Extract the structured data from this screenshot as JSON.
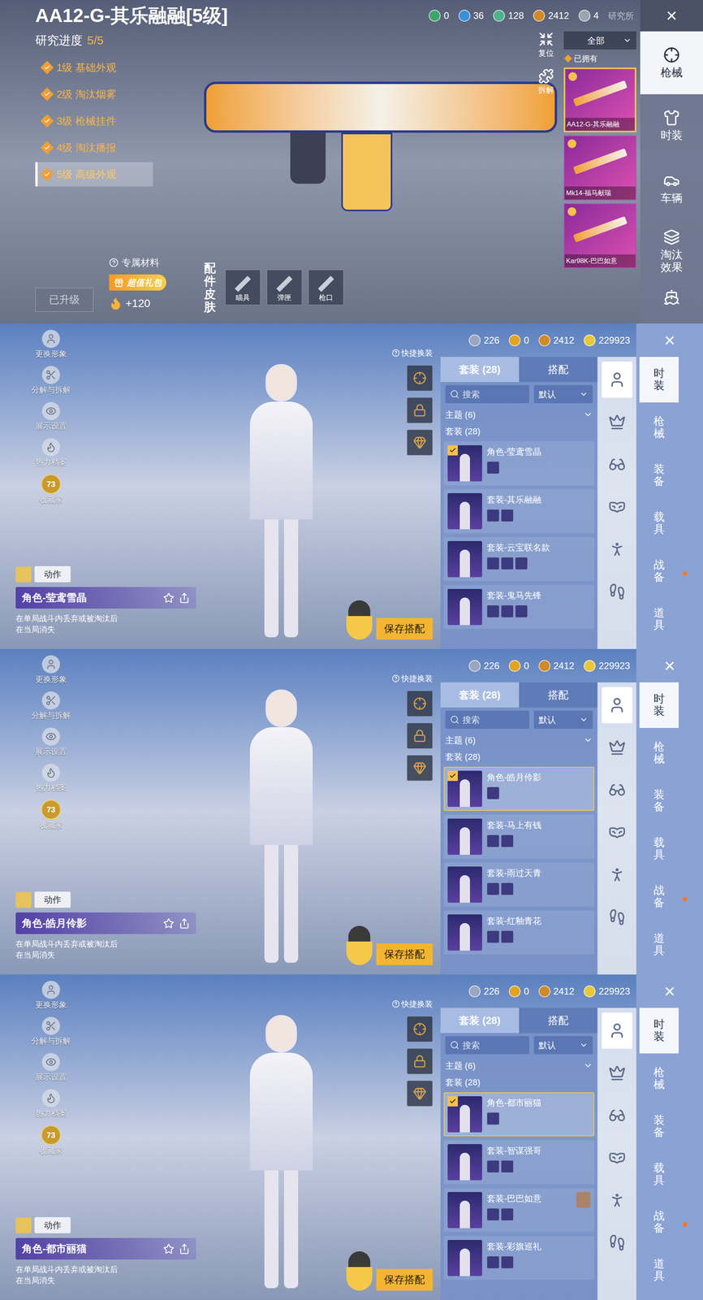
{
  "weapon_panel": {
    "title": "AA12-G-其乐融融[5级]",
    "progress": {
      "label": "研究进度",
      "value": "5/5"
    },
    "levels": [
      {
        "label": "1级 基础外观",
        "done": true,
        "selected": false
      },
      {
        "label": "2级 淘汰烟雾",
        "done": true,
        "selected": false
      },
      {
        "label": "3级 枪械挂件",
        "done": true,
        "selected": false
      },
      {
        "label": "4级 淘汰播报",
        "done": true,
        "selected": false
      },
      {
        "label": "5级 高级外观",
        "done": true,
        "selected": true
      }
    ],
    "currencies": [
      {
        "value": "0",
        "color": "#3fa56b"
      },
      {
        "value": "36",
        "color": "#3b8fd6"
      },
      {
        "value": "128",
        "color": "#4fb08a"
      },
      {
        "value": "2412",
        "color": "#d08a2a"
      },
      {
        "value": "4",
        "color": "#9aa3b0"
      }
    ],
    "lab": "研究所",
    "close": "×",
    "tools": [
      "复位",
      "拆解"
    ],
    "filter": "全部",
    "owned": "已拥有",
    "skins": [
      {
        "name": "AA12-G-其乐融融",
        "selected": true
      },
      {
        "name": "Mk14-福马献瑞",
        "selected": false
      },
      {
        "name": "Kar98K-巴巴如意",
        "selected": false
      }
    ],
    "nav": [
      {
        "label": "枪械",
        "selected": true
      },
      {
        "label": "时装",
        "selected": false
      },
      {
        "label": "车辆",
        "selected": false
      },
      {
        "label": "淘汰效果",
        "selected": false
      }
    ],
    "materials": "专属材料",
    "gift": "超值礼包",
    "material_count": "+120",
    "upgrade": {
      "label": "已升级",
      "disabled": true
    },
    "accessories_title": "配件皮肤",
    "accessories": [
      "瞄具",
      "弹匣",
      "枪口"
    ]
  },
  "outfit_panels": [
    {
      "currencies": [
        {
          "value": "226",
          "color": "#9aa6c0"
        },
        {
          "value": "0",
          "color": "#e0a526"
        },
        {
          "value": "2412",
          "color": "#d08a2a"
        },
        {
          "value": "229923",
          "color": "#e8c83a"
        }
      ],
      "close": "×",
      "menu": [
        "更换形象",
        "分解与拆解",
        "展示设置",
        "热力档案",
        "收藏家"
      ],
      "collector_level": "73",
      "action": "动作",
      "character": "角色-莹鸢雪晶",
      "notes": [
        "在单局战斗内丢弃或被淘汰后",
        "在当局消失"
      ],
      "quick_change": "快捷换装",
      "tabs": [
        {
          "label": "套装 (28)",
          "selected": true
        },
        {
          "label": "搭配",
          "selected": false
        }
      ],
      "search": "搜索",
      "sort": "默认",
      "theme": "主题 (6)",
      "sets": "套装 (28)",
      "items": [
        {
          "name": "角色-莹鸢雪晶",
          "parts": 1,
          "equipped": true,
          "selected": false,
          "friend": false
        },
        {
          "name": "套装-其乐融融",
          "parts": 2,
          "equipped": false,
          "selected": false,
          "friend": false
        },
        {
          "name": "套装-云宝联名款",
          "parts": 3,
          "equipped": false,
          "selected": false,
          "friend": false
        },
        {
          "name": "套装-鬼马先锋",
          "parts": 3,
          "equipped": false,
          "selected": false,
          "friend": false
        }
      ],
      "save": "保存搭配",
      "slots": [
        {
          "selected": true
        },
        {
          "selected": false
        },
        {
          "selected": false
        },
        {
          "selected": false
        },
        {
          "selected": false
        },
        {
          "selected": false
        }
      ],
      "categories": [
        {
          "label": "时装",
          "selected": true,
          "alert": false
        },
        {
          "label": "枪械",
          "selected": false,
          "alert": false
        },
        {
          "label": "装备",
          "selected": false,
          "alert": false
        },
        {
          "label": "载具",
          "selected": false,
          "alert": false
        },
        {
          "label": "战备",
          "selected": false,
          "alert": true
        },
        {
          "label": "道具",
          "selected": false,
          "alert": false
        }
      ]
    },
    {
      "currencies": [
        {
          "value": "226",
          "color": "#9aa6c0"
        },
        {
          "value": "0",
          "color": "#e0a526"
        },
        {
          "value": "2412",
          "color": "#d08a2a"
        },
        {
          "value": "229923",
          "color": "#e8c83a"
        }
      ],
      "close": "×",
      "menu": [
        "更换形象",
        "分解与拆解",
        "展示设置",
        "热力档案",
        "收藏家"
      ],
      "collector_level": "73",
      "action": "动作",
      "character": "角色-皓月伶影",
      "notes": [
        "在单局战斗内丢弃或被淘汰后",
        "在当局消失"
      ],
      "quick_change": "快捷换装",
      "tabs": [
        {
          "label": "套装 (28)",
          "selected": true
        },
        {
          "label": "搭配",
          "selected": false
        }
      ],
      "search": "搜索",
      "sort": "默认",
      "theme": "主题 (6)",
      "sets": "套装 (28)",
      "items": [
        {
          "name": "角色-皓月伶影",
          "parts": 1,
          "equipped": true,
          "selected": true,
          "friend": false
        },
        {
          "name": "套装-马上有钱",
          "parts": 2,
          "equipped": false,
          "selected": false,
          "friend": false
        },
        {
          "name": "套装-雨过天青",
          "parts": 2,
          "equipped": false,
          "selected": false,
          "friend": false
        },
        {
          "name": "套装-红釉青花",
          "parts": 2,
          "equipped": false,
          "selected": false,
          "friend": false
        }
      ],
      "save": "保存搭配",
      "slots": [
        {
          "selected": true
        },
        {
          "selected": false
        },
        {
          "selected": false
        },
        {
          "selected": false
        },
        {
          "selected": false
        },
        {
          "selected": false
        }
      ],
      "categories": [
        {
          "label": "时装",
          "selected": true,
          "alert": false
        },
        {
          "label": "枪械",
          "selected": false,
          "alert": false
        },
        {
          "label": "装备",
          "selected": false,
          "alert": false
        },
        {
          "label": "载具",
          "selected": false,
          "alert": false
        },
        {
          "label": "战备",
          "selected": false,
          "alert": true
        },
        {
          "label": "道具",
          "selected": false,
          "alert": false
        }
      ]
    },
    {
      "currencies": [
        {
          "value": "226",
          "color": "#9aa6c0"
        },
        {
          "value": "0",
          "color": "#e0a526"
        },
        {
          "value": "2412",
          "color": "#d08a2a"
        },
        {
          "value": "229923",
          "color": "#e8c83a"
        }
      ],
      "close": "×",
      "menu": [
        "更换形象",
        "分解与拆解",
        "展示设置",
        "热力档案",
        "收藏家"
      ],
      "collector_level": "73",
      "action": "动作",
      "character": "角色-都市丽猫",
      "notes": [
        "在单局战斗内丢弃或被淘汰后",
        "在当局消失"
      ],
      "quick_change": "快捷换装",
      "tabs": [
        {
          "label": "套装 (28)",
          "selected": true
        },
        {
          "label": "搭配",
          "selected": false
        }
      ],
      "search": "搜索",
      "sort": "默认",
      "theme": "主题 (6)",
      "sets": "套装 (28)",
      "items": [
        {
          "name": "角色-都市丽猫",
          "parts": 1,
          "equipped": true,
          "selected": true,
          "friend": false
        },
        {
          "name": "套装-智谋强哥",
          "parts": 2,
          "equipped": false,
          "selected": false,
          "friend": false
        },
        {
          "name": "套装-巴巴如意",
          "parts": 2,
          "equipped": false,
          "selected": false,
          "friend": true
        },
        {
          "name": "套装-彩旗巡礼",
          "parts": 2,
          "equipped": false,
          "selected": false,
          "friend": false
        }
      ],
      "save": "保存搭配",
      "slots": [
        {
          "selected": true
        },
        {
          "selected": false
        },
        {
          "selected": false
        },
        {
          "selected": false
        },
        {
          "selected": false
        },
        {
          "selected": false
        }
      ],
      "categories": [
        {
          "label": "时装",
          "selected": true,
          "alert": false
        },
        {
          "label": "枪械",
          "selected": false,
          "alert": false
        },
        {
          "label": "装备",
          "selected": false,
          "alert": false
        },
        {
          "label": "载具",
          "selected": false,
          "alert": false
        },
        {
          "label": "战备",
          "selected": false,
          "alert": true
        },
        {
          "label": "道具",
          "selected": false,
          "alert": false
        }
      ]
    }
  ]
}
